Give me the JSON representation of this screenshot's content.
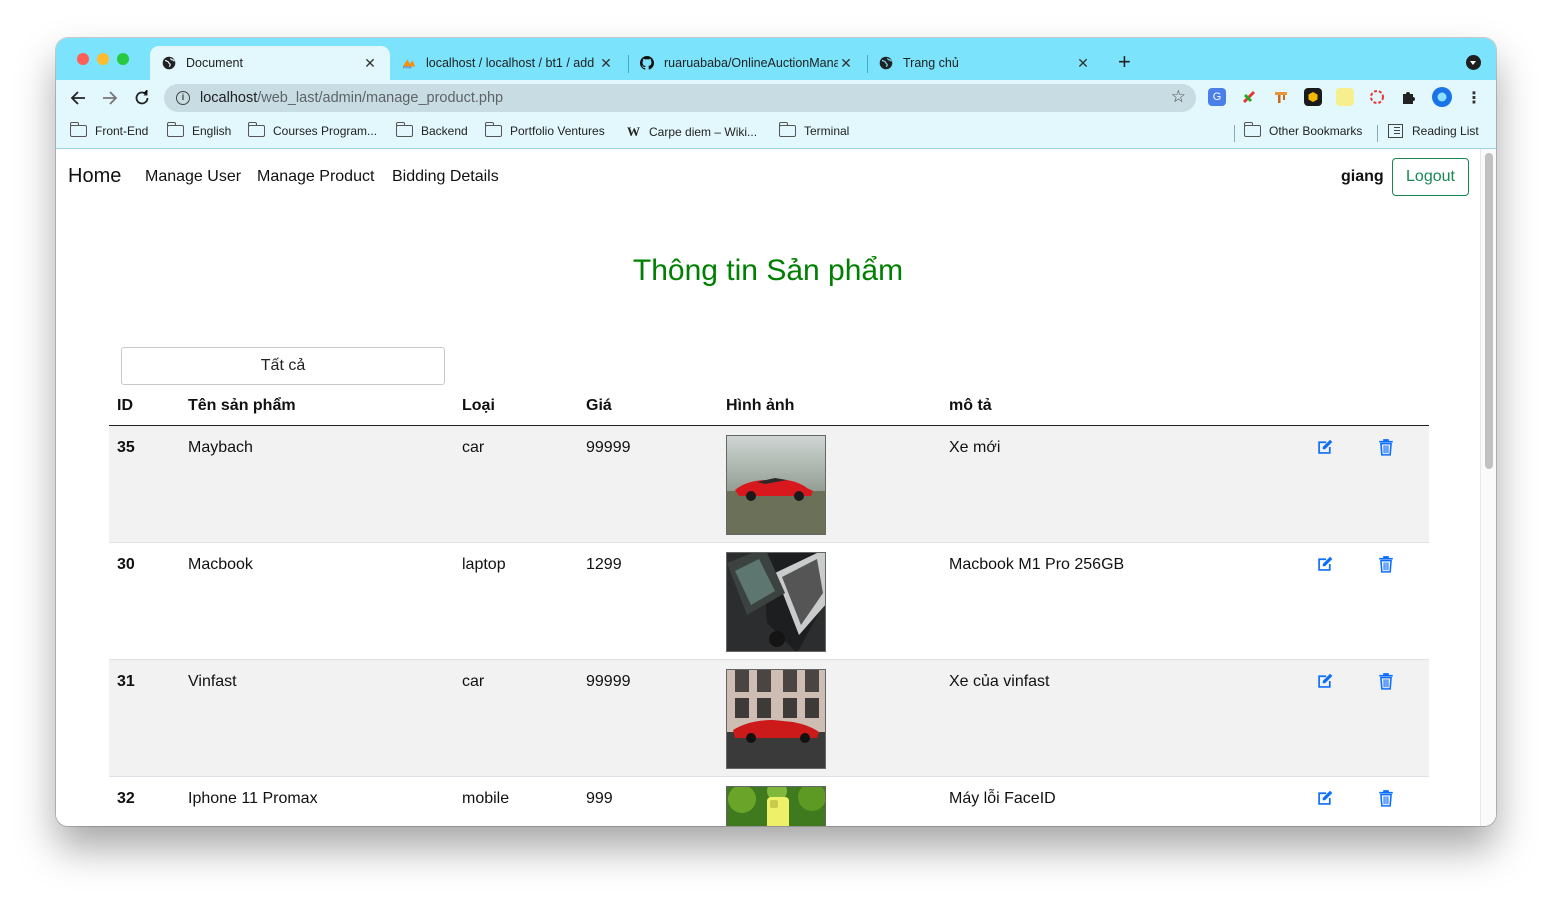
{
  "browser": {
    "tabs": [
      {
        "title": "Document",
        "favicon": "globe-icon",
        "active": true
      },
      {
        "title": "localhost / localhost / bt1 / add",
        "favicon": "phpmyadmin-icon",
        "active": false
      },
      {
        "title": "ruaruababa/OnlineAuctionManagement",
        "favicon": "github-icon",
        "active": false
      },
      {
        "title": "Trang chủ",
        "favicon": "globe-icon",
        "active": false
      }
    ],
    "url_host": "localhost",
    "url_path": "/web_last/admin/manage_product.php",
    "bookmarks": [
      {
        "label": "Front-End",
        "icon": "folder-icon"
      },
      {
        "label": "English",
        "icon": "folder-icon"
      },
      {
        "label": "Courses Program...",
        "icon": "folder-icon"
      },
      {
        "label": "Backend",
        "icon": "folder-icon"
      },
      {
        "label": "Portfolio Ventures",
        "icon": "folder-icon"
      },
      {
        "label": "Carpe diem – Wiki...",
        "icon": "wikipedia-icon"
      },
      {
        "label": "Terminal",
        "icon": "folder-icon"
      }
    ],
    "other_bookmarks": "Other Bookmarks",
    "reading_list": "Reading List",
    "accent": "#7be3fb"
  },
  "navbar": {
    "brand": "Home",
    "links": [
      "Manage User",
      "Manage Product",
      "Bidding Details"
    ],
    "username": "giang",
    "logout": "Logout"
  },
  "page": {
    "title": "Thông tin Sản phẩm",
    "filter_value": "Tất cả",
    "title_color": "#008000"
  },
  "table": {
    "headers": [
      "ID",
      "Tên sản phẩm",
      "Loại",
      "Giá",
      "Hình ảnh",
      "mô tả"
    ],
    "rows": [
      {
        "id": "35",
        "name": "Maybach",
        "type": "car",
        "price": "99999",
        "image": "red-sports-car-photo",
        "description": "Xe mới"
      },
      {
        "id": "30",
        "name": "Macbook",
        "type": "laptop",
        "price": "1299",
        "image": "laptop-photo",
        "description": "Macbook M1 Pro 256GB"
      },
      {
        "id": "31",
        "name": "Vinfast",
        "type": "car",
        "price": "99999",
        "image": "red-car-street-photo",
        "description": "Xe của vinfast"
      },
      {
        "id": "32",
        "name": "Iphone 11 Promax",
        "type": "mobile",
        "price": "999",
        "image": "yellow-phone-photo",
        "description": "Máy lỗi FaceID"
      }
    ]
  },
  "colors": {
    "action_blue": "#0d6efd",
    "logout_green": "#198754"
  }
}
